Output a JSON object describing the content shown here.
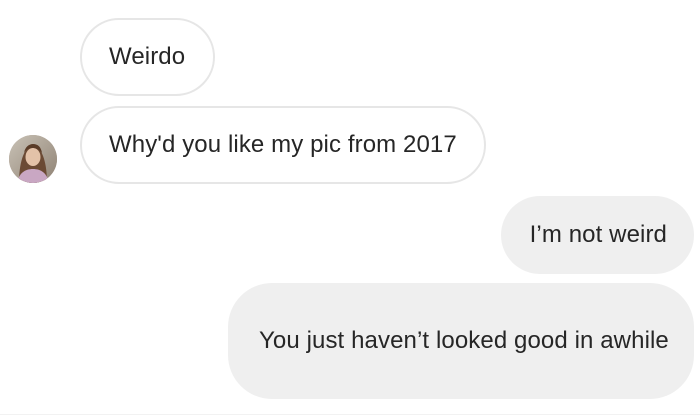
{
  "thread": {
    "messages": [
      {
        "sender": "them",
        "text": "Weirdo"
      },
      {
        "sender": "them",
        "text": "Why'd you like my pic from 2017"
      },
      {
        "sender": "me",
        "text": "I’m not weird"
      },
      {
        "sender": "me",
        "text": "You just haven’t looked good in awhile"
      }
    ],
    "avatar_icon": "profile-photo"
  },
  "colors": {
    "incoming_bubble": "#ffffff",
    "incoming_border": "#e6e6e6",
    "outgoing_bubble": "#efefef",
    "text": "#262626"
  }
}
